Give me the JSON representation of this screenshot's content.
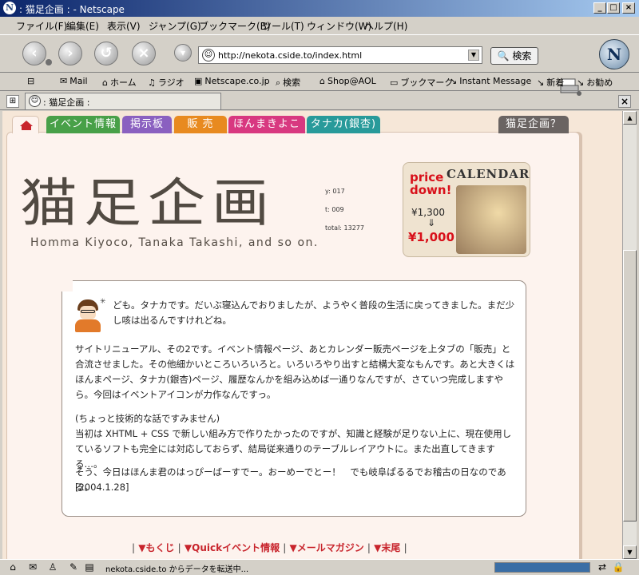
{
  "window": {
    "title": ": 猫足企画 : - Netscape"
  },
  "menu": [
    "ファイル(F)",
    "編集(E)",
    "表示(V)",
    "ジャンプ(G)",
    "ブックマーク(B)",
    "ツール(T)",
    "ウィンドウ(W)",
    "ヘルプ(H)"
  ],
  "navigation": {
    "url": "http://nekota.cside.to/index.html",
    "search_label": "検索"
  },
  "personal_toolbar": [
    "Mail",
    "ホーム",
    "ラジオ",
    "Netscape.co.jp",
    "検索",
    "Shop@AOL",
    "ブックマーク",
    "Instant Message",
    "新着",
    "お勧め"
  ],
  "browser_tab": {
    "label": ": 猫足企画 :"
  },
  "site": {
    "tabs": [
      {
        "label": "イベント情報",
        "color": "#48a048"
      },
      {
        "label": "掲示板",
        "color": "#8a60c0"
      },
      {
        "label": "販 売",
        "color": "#e88a20"
      },
      {
        "label": "ほんまきよこ",
        "color": "#d83880"
      },
      {
        "label": "タナカ(銀杏)",
        "color": "#289a9a"
      }
    ],
    "about_tab": "猫足企画？",
    "logo_text": "猫足企画",
    "tagline": "Homma Kiyoco, Tanaka Takashi, and so on.",
    "counters": {
      "yesterday": "y: 017",
      "today": "t: 009",
      "total": "total: 13277"
    },
    "calendar_banner": {
      "price_down": "price down!",
      "title": "CALENDAR",
      "old_price": "¥1,300",
      "arrow": "⇓",
      "new_price": "¥1,000"
    },
    "message": {
      "p1": "ども。タナカです。だいぶ寝込んでおりましたが、ようやく普段の生活に戻ってきました。まだ少し咳は出るんですけれどね。",
      "p2": "サイトリニューアル、その2です。イベント情報ページ、あとカレンダー販売ページを上タブの「販売」と合流させました。その他細かいところいろいろと。いろいろやり出すと結構大変なもんです。あと大きくはほんまページ、タナカ(銀杏)ページ、履歴なんかを組み込めば一通りなんですが、さていつ完成しますやら。今回はイベントアイコンが力作なんですっ。",
      "p3": "(ちょっと技術的な話ですみません)\n当初は XHTML + CSS で新しい組み方で作りたかったのですが、知識と経験が足りない上に、現在使用しているソフトも完全には対応しておらず、結局従来通りのテーブルレイアウトに。また出直してきまする…。",
      "p4": "そう、今日はほんま君のはっぴーばーすでー。おーめーでとー！　でも岐阜ぱるるでお稽古の日なのである。",
      "date": "[2004.1.28]"
    },
    "bottom_nav": [
      "▼もくじ",
      "▼Quickイベント情報",
      "▼メールマガジン",
      "▼末尾"
    ]
  },
  "status": {
    "text": "nekota.cside.to からデータを転送中..."
  },
  "icons": {
    "app": "netscape-icon",
    "back": "back-arrow-icon",
    "forward": "forward-arrow-icon",
    "reload": "reload-icon",
    "stop": "stop-icon"
  }
}
